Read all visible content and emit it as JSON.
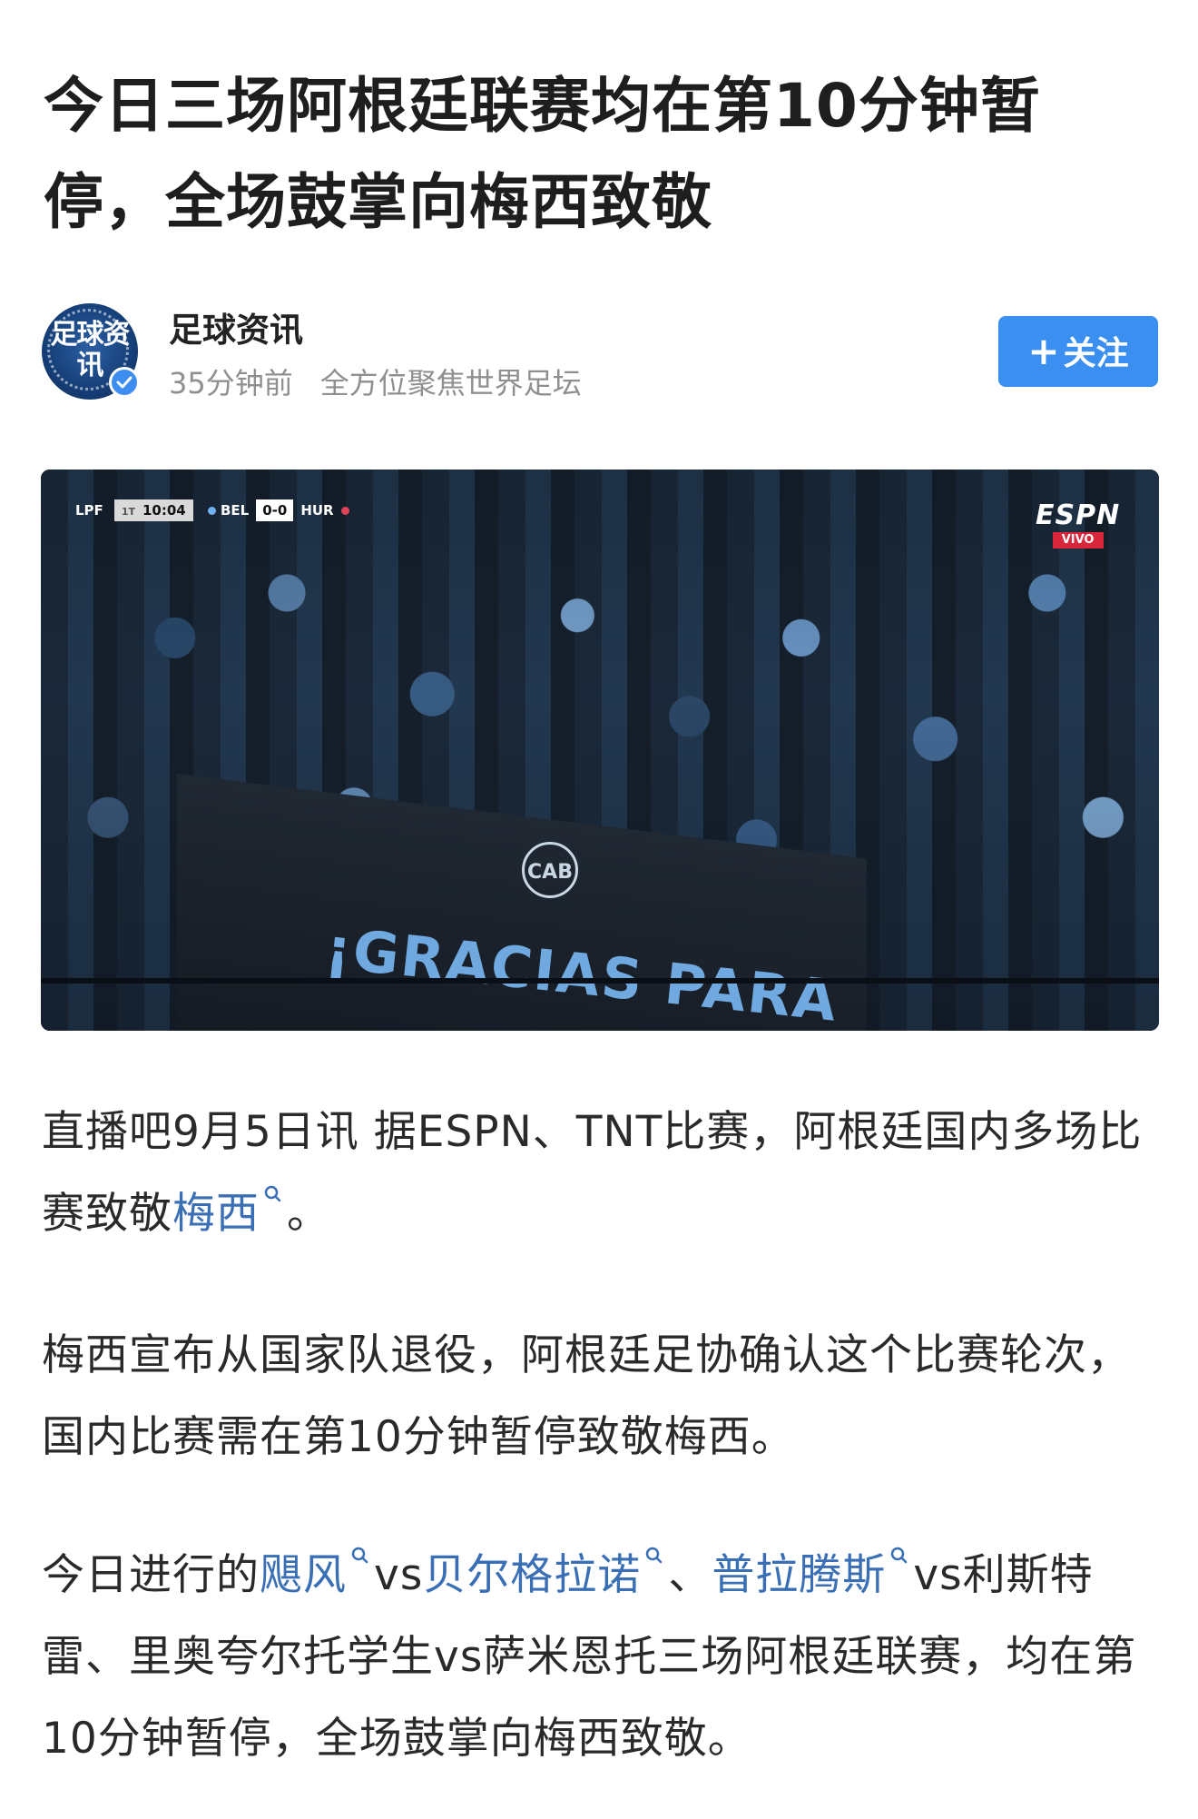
{
  "article": {
    "title": "今日三场阿根廷联赛均在第10分钟暂停，全场鼓掌向梅西致敬"
  },
  "author": {
    "avatar_text": "足球资讯",
    "name": "足球资讯",
    "time": "35分钟前",
    "description": "全方位聚焦世界足坛",
    "follow_label": "关注"
  },
  "media": {
    "scorebug": {
      "league": "LPF",
      "half": "1T",
      "clock": "10:04",
      "home": "BEL",
      "score": "0-0",
      "away": "HUR"
    },
    "broadcaster": "ESPN",
    "live_label": "VIVO",
    "banner_text": "¡GRACIAS PARA",
    "banner_logo": "CAB"
  },
  "paragraphs": {
    "p1": {
      "text_a": "直播吧9月5日讯  据ESPN、TNT比赛，阿根廷国内多场比赛致敬",
      "link_messi": "梅西",
      "text_b": "。"
    },
    "p2": {
      "text": "梅西宣布从国家队退役，阿根廷足协确认这个比赛轮次，国内比赛需在第10分钟暂停致敬梅西。"
    },
    "p3": {
      "text_a": "今日进行的",
      "link_1": "飓风",
      "text_b": "vs",
      "link_2": "贝尔格拉诺",
      "text_c": "、",
      "link_3": "普拉腾斯",
      "text_d": "vs利斯特雷、里奥夸尔托学生vs萨米恩托三场阿根廷联赛，均在第10分钟暂停，全场鼓掌向梅西致敬。"
    }
  }
}
